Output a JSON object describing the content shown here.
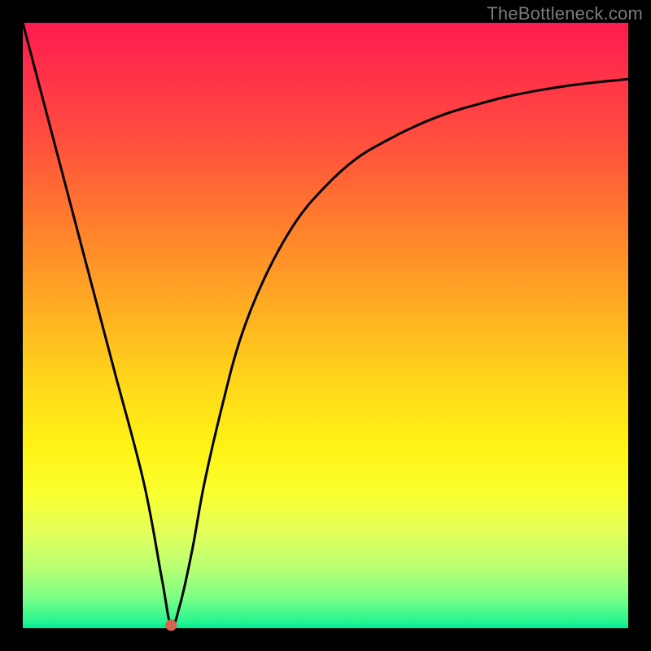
{
  "watermark": "TheBottleneck.com",
  "chart_data": {
    "type": "line",
    "title": "",
    "xlabel": "",
    "ylabel": "",
    "xlim": [
      0,
      100
    ],
    "ylim": [
      0,
      100
    ],
    "grid": false,
    "legend": false,
    "series": [
      {
        "name": "bottleneck-curve",
        "x": [
          0,
          5,
          10,
          15,
          20,
          23,
          24.5,
          26,
          28,
          30,
          33,
          36,
          40,
          45,
          50,
          55,
          60,
          65,
          70,
          75,
          80,
          85,
          90,
          95,
          100
        ],
        "values": [
          100,
          81,
          62,
          43,
          24,
          8,
          0.5,
          4,
          13,
          24,
          37,
          48,
          58,
          67,
          73,
          77.5,
          80.5,
          83,
          85,
          86.5,
          87.8,
          88.8,
          89.6,
          90.2,
          90.7
        ]
      }
    ],
    "marker": {
      "x": 24.5,
      "y": 0.5,
      "color": "#d6624f",
      "radius_px": 7
    },
    "colors": {
      "curve": "#000000",
      "marker": "#d6624f",
      "gradient_top": "#ff1a4f",
      "gradient_bottom": "#00e893",
      "frame": "#000000"
    }
  }
}
